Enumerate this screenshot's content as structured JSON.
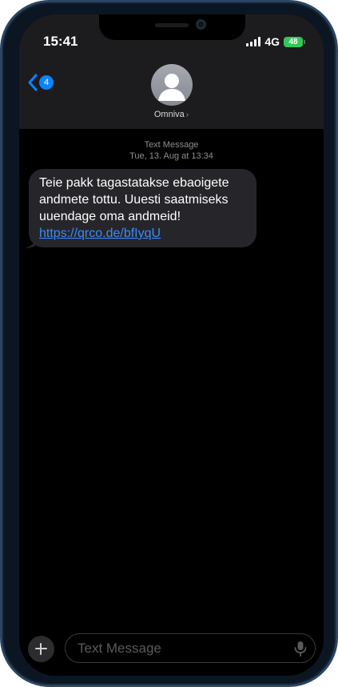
{
  "status_bar": {
    "time": "15:41",
    "network": "4G",
    "battery": "48"
  },
  "header": {
    "back_badge": "4",
    "contact_name": "Omniva",
    "contact_chevron": "›"
  },
  "thread": {
    "service_label": "Text Message",
    "timestamp": "Tue, 13. Aug at 13:34",
    "messages": [
      {
        "direction": "incoming",
        "text": "Teie pakk tagastatakse ebaoigete andmete tottu. Uuesti saatmiseks uuendage oma andmeid!",
        "link": "https://qrco.de/bfIyqU"
      }
    ]
  },
  "compose": {
    "placeholder": "Text Message"
  },
  "colors": {
    "accent": "#0a84ff",
    "link": "#3a8bff",
    "bubble": "#26262a",
    "battery": "#34c759",
    "header_bg": "#1c1c1e"
  },
  "icons": {
    "back": "chevron-left-icon",
    "avatar": "person-silhouette-icon",
    "add": "plus-icon",
    "dictation": "microphone-icon",
    "signal": "cellular-signal-icon",
    "battery": "battery-icon"
  }
}
